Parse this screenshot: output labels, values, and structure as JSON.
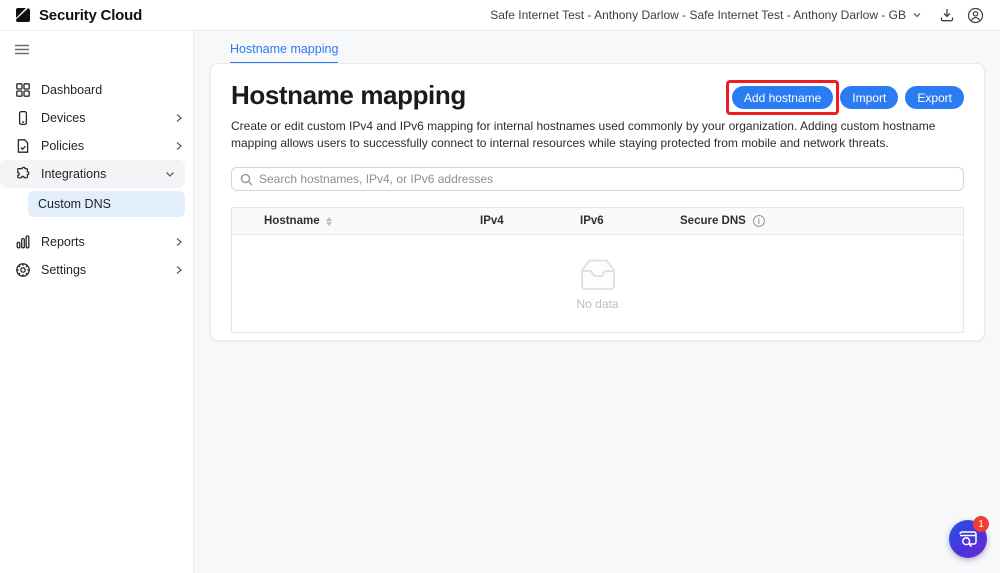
{
  "header": {
    "brand": "Security Cloud",
    "account_switcher": "Safe Internet Test - Anthony Darlow - Safe Internet Test - Anthony Darlow - GB"
  },
  "sidebar": {
    "items": [
      {
        "label": "Dashboard"
      },
      {
        "label": "Devices"
      },
      {
        "label": "Policies"
      },
      {
        "label": "Integrations"
      },
      {
        "label": "Custom DNS"
      },
      {
        "label": "Reports"
      },
      {
        "label": "Settings"
      }
    ]
  },
  "main": {
    "tab": "Hostname mapping",
    "title": "Hostname mapping",
    "description": "Create or edit custom IPv4 and IPv6 mapping for internal hostnames used commonly by your organization. Adding custom hostname mapping allows users to successfully connect to internal resources while staying protected from mobile and network threats.",
    "buttons": {
      "add": "Add hostname",
      "import": "Import",
      "export": "Export"
    },
    "search": {
      "placeholder": "Search hostnames, IPv4, or IPv6 addresses"
    },
    "table": {
      "columns": [
        "Hostname",
        "IPv4",
        "IPv6",
        "Secure DNS"
      ],
      "empty_text": "No data"
    }
  },
  "chat": {
    "badge": "1"
  },
  "colors": {
    "accent_blue": "#2b7bf3",
    "highlight_red": "#ee1c25",
    "badge_red": "#f23c32",
    "selected_item_bg": "#e2eefc",
    "page_bg": "#f7f8fa"
  }
}
